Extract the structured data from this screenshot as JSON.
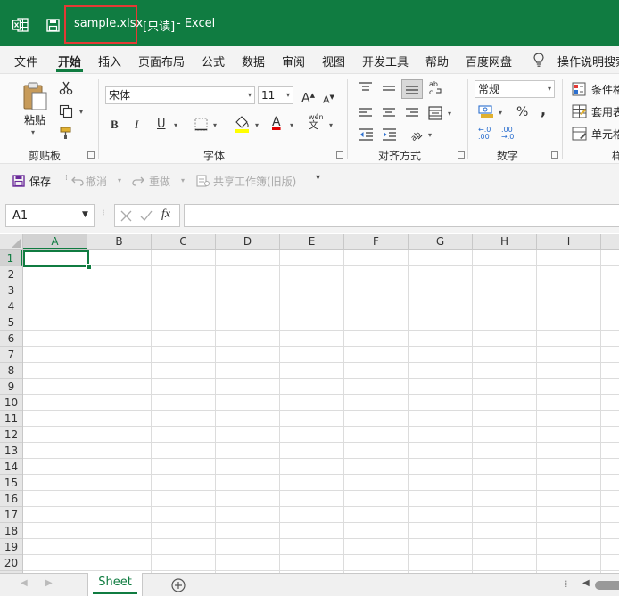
{
  "window": {
    "filename": "sample.xlsx",
    "readonly": "[只读]",
    "app_suffix": "- Excel",
    "accent_color": "#107c41",
    "highlight_color": "#e53935"
  },
  "menu": {
    "items": [
      "文件",
      "开始",
      "插入",
      "页面布局",
      "公式",
      "数据",
      "审阅",
      "视图",
      "开发工具",
      "帮助",
      "百度网盘"
    ],
    "active": "开始",
    "tell_me": "操作说明搜索"
  },
  "ribbon": {
    "clipboard": {
      "label": "剪贴板",
      "paste_label": "粘贴"
    },
    "font": {
      "label": "字体",
      "font_name": "宋体",
      "font_size": "11",
      "phonetic_top": "wén",
      "phonetic_bottom": "文"
    },
    "alignment": {
      "label": "对齐方式",
      "wrap": "ab\nc"
    },
    "number": {
      "label": "数字",
      "format": "常规"
    },
    "styles": {
      "label": "样",
      "conditional": "条件格",
      "table": "套用表",
      "cell": "单元格"
    }
  },
  "quick_access": {
    "save": "保存",
    "undo": "撤消",
    "redo": "重做",
    "share": "共享工作簿(旧版)"
  },
  "formula_bar": {
    "name_box": "A1",
    "fx": "fx",
    "value": ""
  },
  "grid": {
    "columns": [
      "A",
      "B",
      "C",
      "D",
      "E",
      "F",
      "G",
      "H",
      "I"
    ],
    "rows": [
      "1",
      "2",
      "3",
      "4",
      "5",
      "6",
      "7",
      "8",
      "9",
      "10",
      "11",
      "12",
      "13",
      "14",
      "15",
      "16",
      "17",
      "18",
      "19",
      "20"
    ],
    "selected_cell": "A1"
  },
  "sheets": {
    "tabs": [
      "Sheet"
    ],
    "active": "Sheet"
  }
}
